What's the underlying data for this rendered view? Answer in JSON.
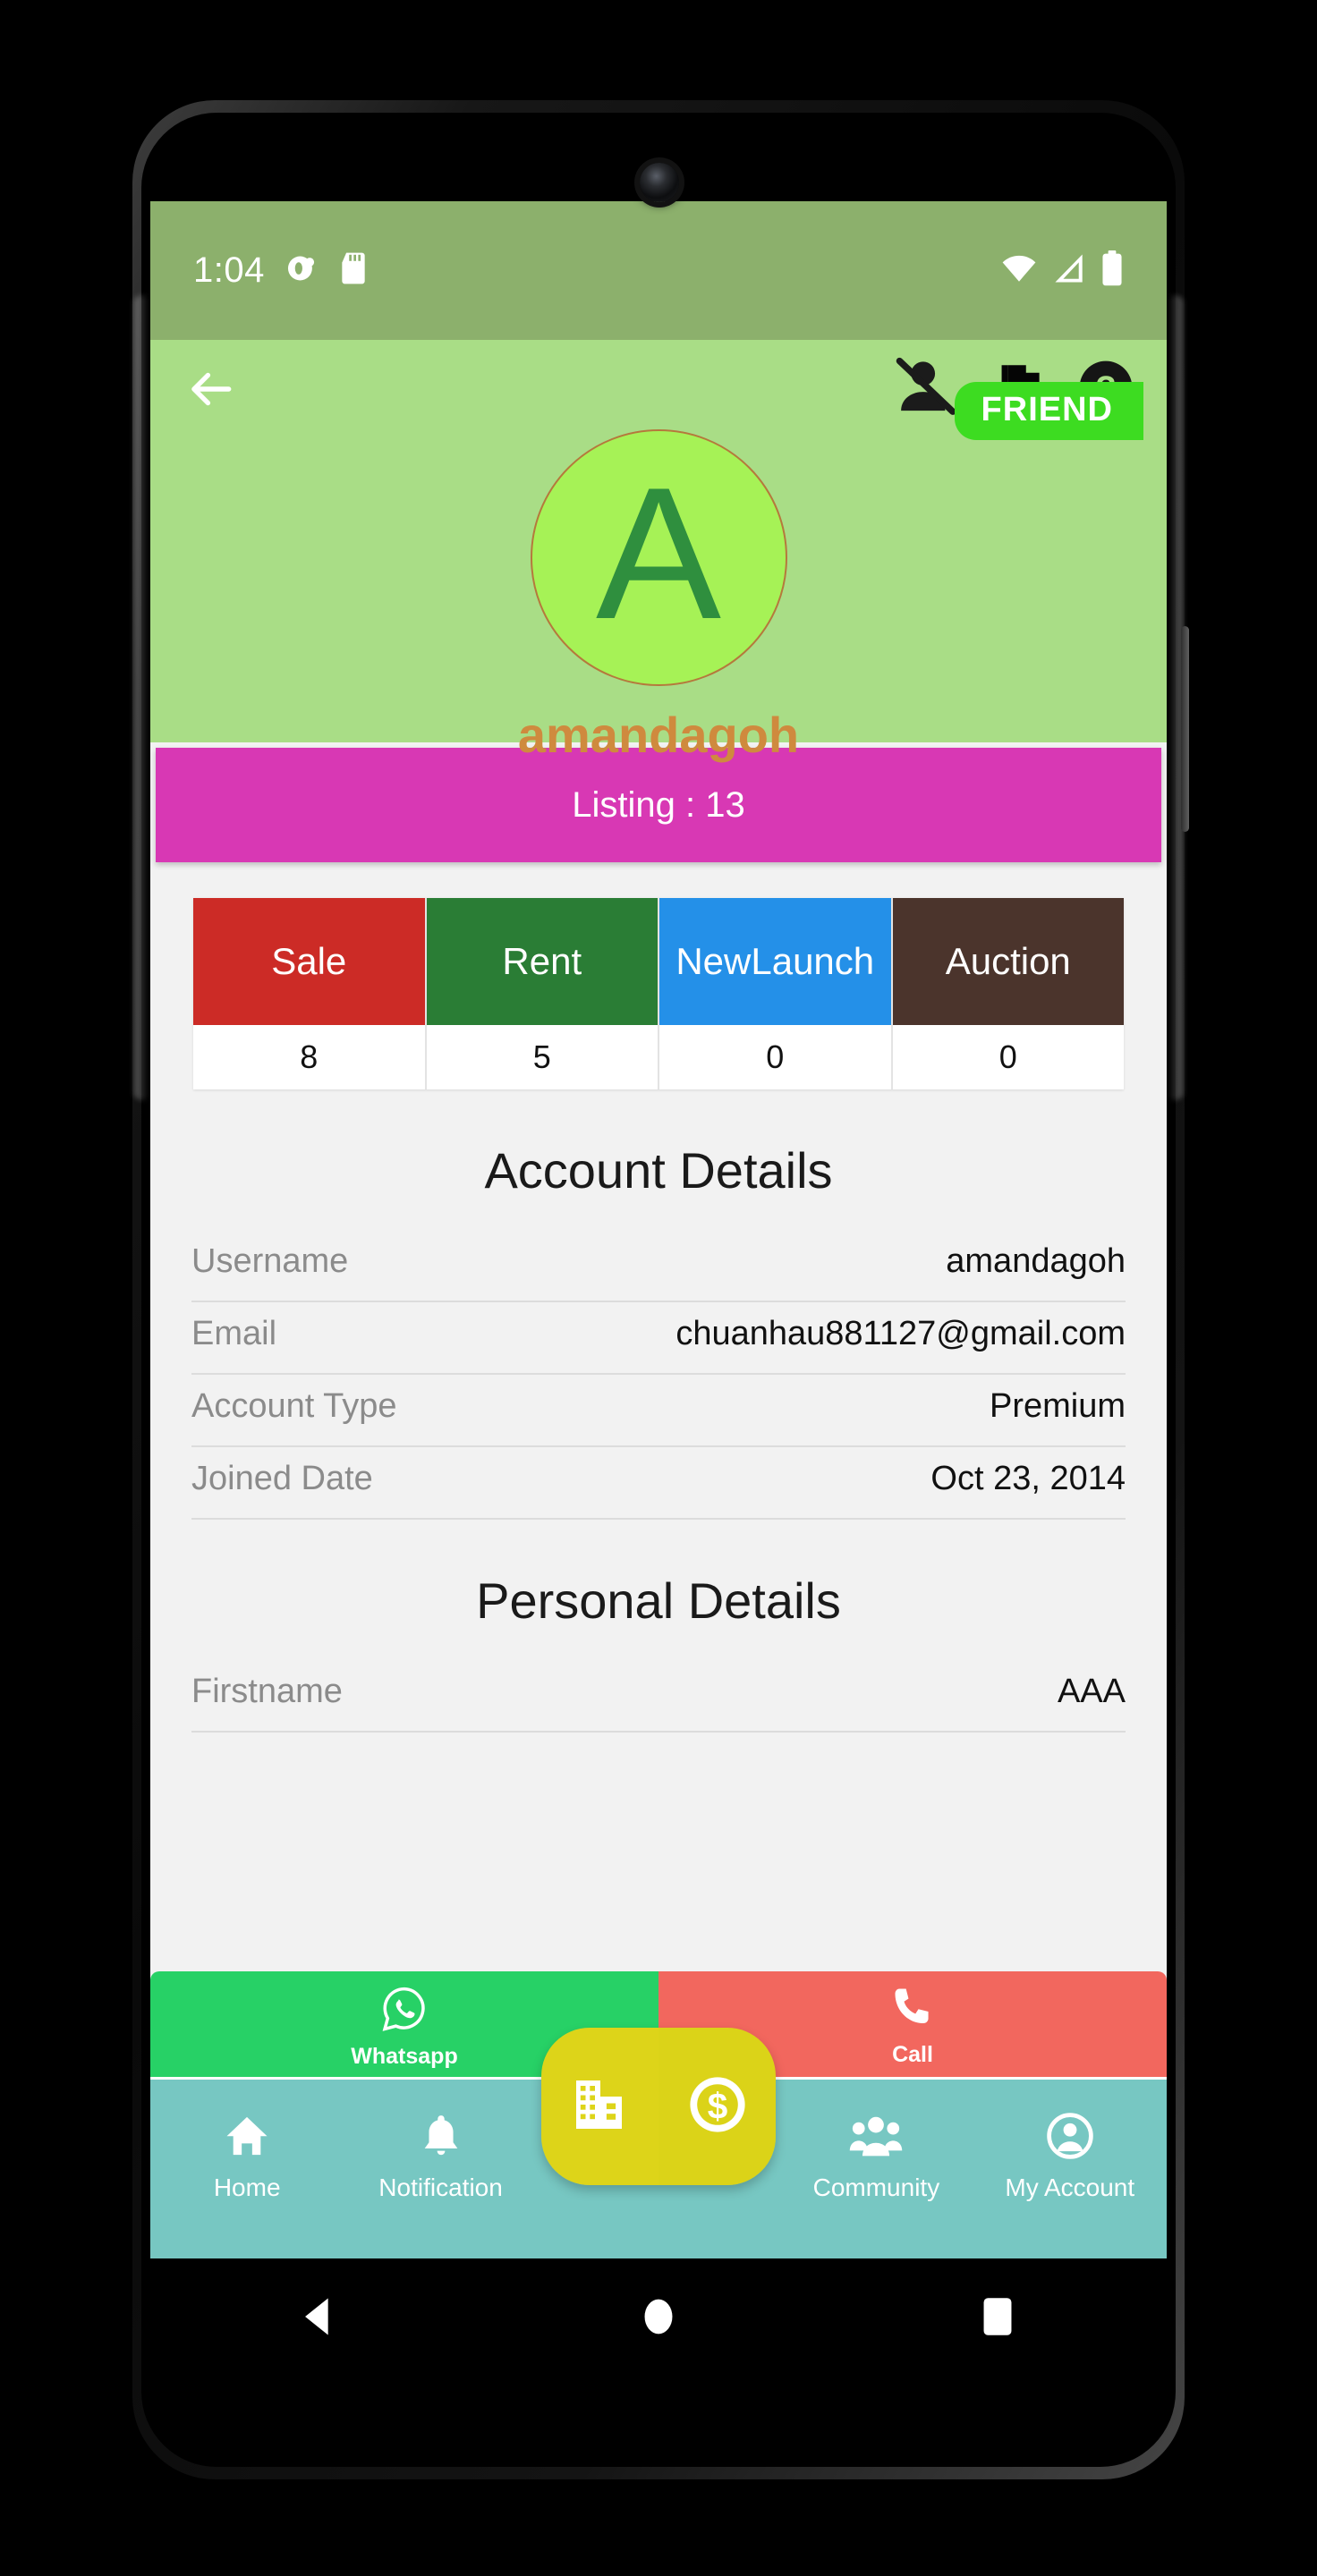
{
  "status_bar": {
    "time": "1:04",
    "left_icons": [
      "contacts-sync-icon",
      "sd-card-icon"
    ],
    "right_icons": [
      "wifi-icon",
      "cellular-signal-icon",
      "battery-icon"
    ],
    "background_color": "#8cb06c"
  },
  "header": {
    "back_icon": "back-arrow-icon",
    "block_user_icon": "block-user-icon",
    "flag_icon": "flag-icon",
    "help_icon": "help-question-icon",
    "friend_badge": "FRIEND",
    "friend_badge_color": "#3ddc21",
    "avatar_initial": "A",
    "avatar_bg": "#a6f256",
    "avatar_text_color": "#2f8f3e",
    "username": "amandagoh",
    "username_color": "#cf8a3e",
    "background_color": "#a9dd86"
  },
  "listing": {
    "label": "Listing : 13",
    "color": "#d838b4"
  },
  "categories": {
    "columns": [
      {
        "label": "Sale",
        "value": "8",
        "color": "#cc2b26"
      },
      {
        "label": "Rent",
        "value": "5",
        "color": "#2a7d35"
      },
      {
        "label": "New\nLaunch",
        "value": "0",
        "color": "#2490e8"
      },
      {
        "label": "Auction",
        "value": "0",
        "color": "#4b342c"
      }
    ]
  },
  "account_details": {
    "title": "Account Details",
    "rows": [
      {
        "label": "Username",
        "value": "amandagoh"
      },
      {
        "label": "Email",
        "value": "chuanhau881127@gmail.com"
      },
      {
        "label": "Account Type",
        "value": "Premium"
      },
      {
        "label": "Joined Date",
        "value": "Oct 23, 2014"
      }
    ]
  },
  "personal_details": {
    "title": "Personal Details",
    "rows": [
      {
        "label": "Firstname",
        "value": "AAA"
      }
    ]
  },
  "action_bar": {
    "whatsapp": {
      "label": "Whatsapp",
      "icon": "whatsapp-icon",
      "color": "#27d166"
    },
    "call": {
      "label": "Call",
      "icon": "phone-icon",
      "color": "#f2675e"
    }
  },
  "bottom_nav": {
    "background_color": "#77c7c2",
    "items": [
      {
        "label": "Home",
        "icon": "home-icon"
      },
      {
        "label": "Notification",
        "icon": "bell-icon"
      },
      {
        "label": "Community",
        "icon": "people-icon"
      },
      {
        "label": "My Account",
        "icon": "account-circle-icon"
      }
    ],
    "fab": [
      {
        "icon": "building-icon",
        "color": "#ddd419"
      },
      {
        "icon": "dollar-coin-icon",
        "color": "#dbd318"
      }
    ]
  },
  "android_nav": {
    "buttons": [
      {
        "icon": "nav-back-triangle-icon"
      },
      {
        "icon": "nav-home-circle-icon"
      },
      {
        "icon": "nav-recents-square-icon"
      }
    ]
  }
}
